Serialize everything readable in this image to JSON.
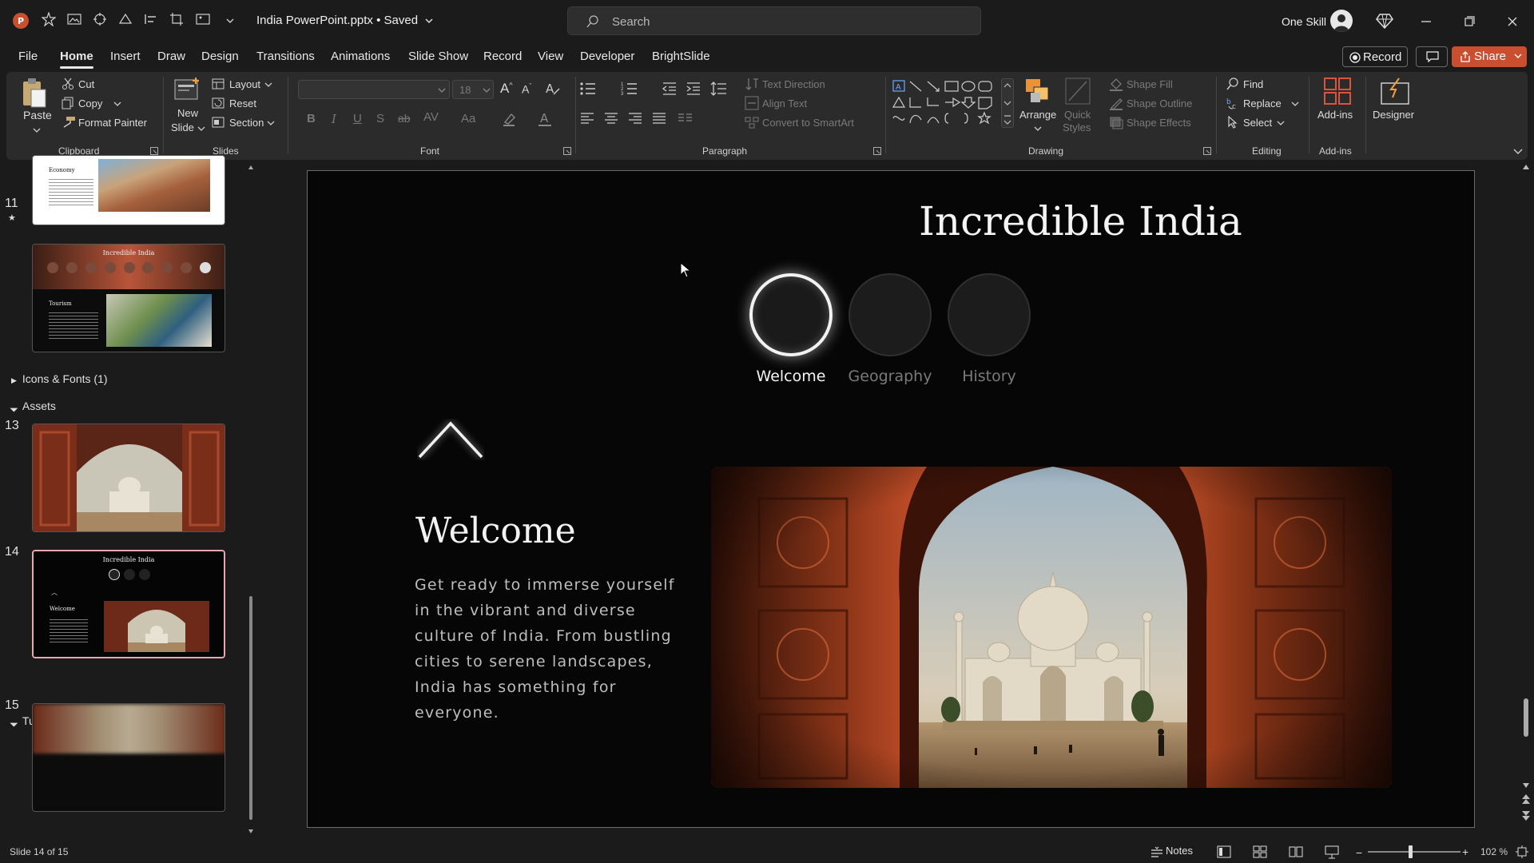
{
  "title_bar": {
    "doc_title": "India PowerPoint.pptx • Saved",
    "search_placeholder": "Search",
    "user_name": "One Skill"
  },
  "menu": {
    "tabs": [
      "File",
      "Home",
      "Insert",
      "Draw",
      "Design",
      "Transitions",
      "Animations",
      "Slide Show",
      "Record",
      "View",
      "Developer",
      "BrightSlide"
    ],
    "active_tab": "Home",
    "record_label": "Record",
    "share_label": "Share"
  },
  "ribbon": {
    "clipboard": {
      "paste": "Paste",
      "cut": "Cut",
      "copy": "Copy",
      "format_painter": "Format Painter",
      "label": "Clipboard"
    },
    "slides": {
      "new_slide_1": "New",
      "new_slide_2": "Slide",
      "layout": "Layout",
      "reset": "Reset",
      "section": "Section",
      "label": "Slides"
    },
    "font": {
      "font_name": "",
      "font_size": "18",
      "label": "Font"
    },
    "paragraph": {
      "text_direction": "Text Direction",
      "align_text": "Align Text",
      "convert_smartart": "Convert to SmartArt",
      "label": "Paragraph"
    },
    "drawing": {
      "arrange": "Arrange",
      "quick_styles_1": "Quick",
      "quick_styles_2": "Styles",
      "shape_fill": "Shape Fill",
      "shape_outline": "Shape Outline",
      "shape_effects": "Shape Effects",
      "label": "Drawing"
    },
    "editing": {
      "find": "Find",
      "replace": "Replace",
      "select": "Select",
      "label": "Editing"
    },
    "addins": {
      "addins": "Add-ins",
      "designer": "Designer",
      "label": "Add-ins"
    }
  },
  "thumbnails": {
    "slide_11_num": "11",
    "slide_13_num": "13",
    "slide_14_num": "14",
    "slide_15_num": "15",
    "section_icons_fonts": "Icons & Fonts (1)",
    "section_assets": "Assets",
    "section_tutorial": "Tutorial",
    "thumb10_heading": "Economy",
    "thumb11_title": "Incredible India",
    "thumb11_heading": "Tourism",
    "thumb14_title": "Incredible India",
    "thumb14_heading": "Welcome"
  },
  "slide": {
    "title": "Incredible India",
    "nav": [
      {
        "label": "Welcome",
        "active": true
      },
      {
        "label": "Geography",
        "active": false
      },
      {
        "label": "History",
        "active": false
      }
    ],
    "heading": "Welcome",
    "body": "Get ready to immerse yourself in the vibrant and diverse culture of India. From bustling cities to serene landscapes, India has something for everyone."
  },
  "status": {
    "slide_counter": "Slide 14 of 15",
    "notes": "Notes",
    "zoom": "102 %"
  },
  "colors": {
    "accent_share": "#c94f2e",
    "selected_thumb": "#e9a7b5",
    "background": "#1b1b1b"
  }
}
